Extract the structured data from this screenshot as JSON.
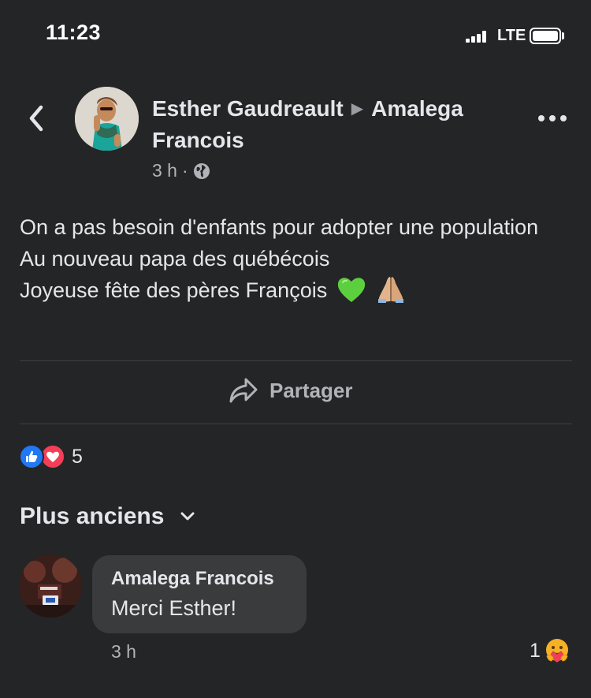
{
  "status_bar": {
    "time": "11:23",
    "network": "LTE"
  },
  "header": {
    "author": "Esther Gaudreault",
    "target": "Amalega Francois",
    "timestamp": "3 h",
    "separator": "·",
    "audience_icon": "globe-icon"
  },
  "post": {
    "lines": [
      "On a pas besoin d'enfants pour adopter une population",
      "Au nouveau papa des québécois",
      "Joyeuse fête des pères François"
    ],
    "emojis": [
      "green-heart",
      "folded-hands"
    ]
  },
  "actions": {
    "share_label": "Partager"
  },
  "reactions": {
    "count": "5",
    "types": [
      "like",
      "love"
    ]
  },
  "comments_sort": {
    "label": "Plus anciens"
  },
  "comment": {
    "author": "Amalega Francois",
    "text": "Merci Esther!",
    "timestamp": "3 h",
    "reaction_count": "1",
    "reaction_type": "care"
  },
  "colors": {
    "background": "#242526",
    "bubble": "#3a3b3c",
    "text_primary": "#e4e6eb",
    "text_secondary": "#b0b3b8",
    "like": "#2078f4",
    "love": "#f33e58"
  }
}
